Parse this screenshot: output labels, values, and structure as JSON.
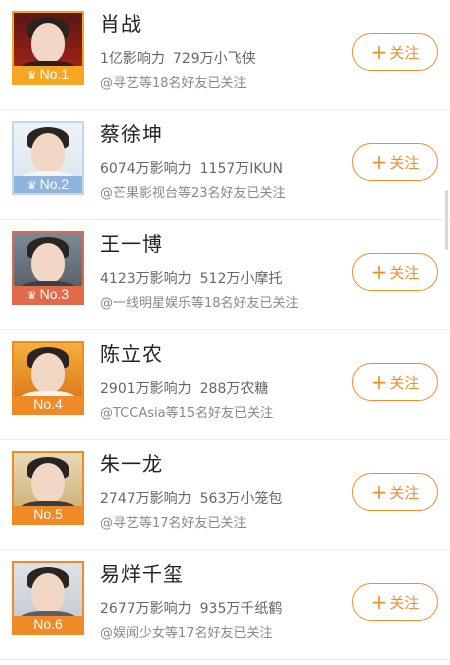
{
  "colors": {
    "accent": "#f08e2b",
    "gold_badge": "#f5a623",
    "blue_badge": "#8fb4dd",
    "red_badge": "#e06a4a",
    "orange_badge": "#f08a26"
  },
  "rows": [
    {
      "name": "肖战",
      "influence": "1亿影响力",
      "fans": "729万小飞侠",
      "friends": "@寻艺等18名好友已关注",
      "rank": "No.1",
      "follow_label": "关注"
    },
    {
      "name": "蔡徐坤",
      "influence": "6074万影响力",
      "fans": "1157万IKUN",
      "friends": "@芒果影视台等23名好友已关注",
      "rank": "No.2",
      "follow_label": "关注"
    },
    {
      "name": "王一博",
      "influence": "4123万影响力",
      "fans": "512万小摩托",
      "friends": "@一线明星娱乐等18名好友已关注",
      "rank": "No.3",
      "follow_label": "关注"
    },
    {
      "name": "陈立农",
      "influence": "2901万影响力",
      "fans": "288万农糖",
      "friends": "@TCCAsia等15名好友已关注",
      "rank": "No.4",
      "follow_label": "关注"
    },
    {
      "name": "朱一龙",
      "influence": "2747万影响力",
      "fans": "563万小笼包",
      "friends": "@寻艺等17名好友已关注",
      "rank": "No.5",
      "follow_label": "关注"
    },
    {
      "name": "易烊千玺",
      "influence": "2677万影响力",
      "fans": "935万千纸鹤",
      "friends": "@娱闻少女等17名好友已关注",
      "rank": "No.6",
      "follow_label": "关注"
    }
  ]
}
